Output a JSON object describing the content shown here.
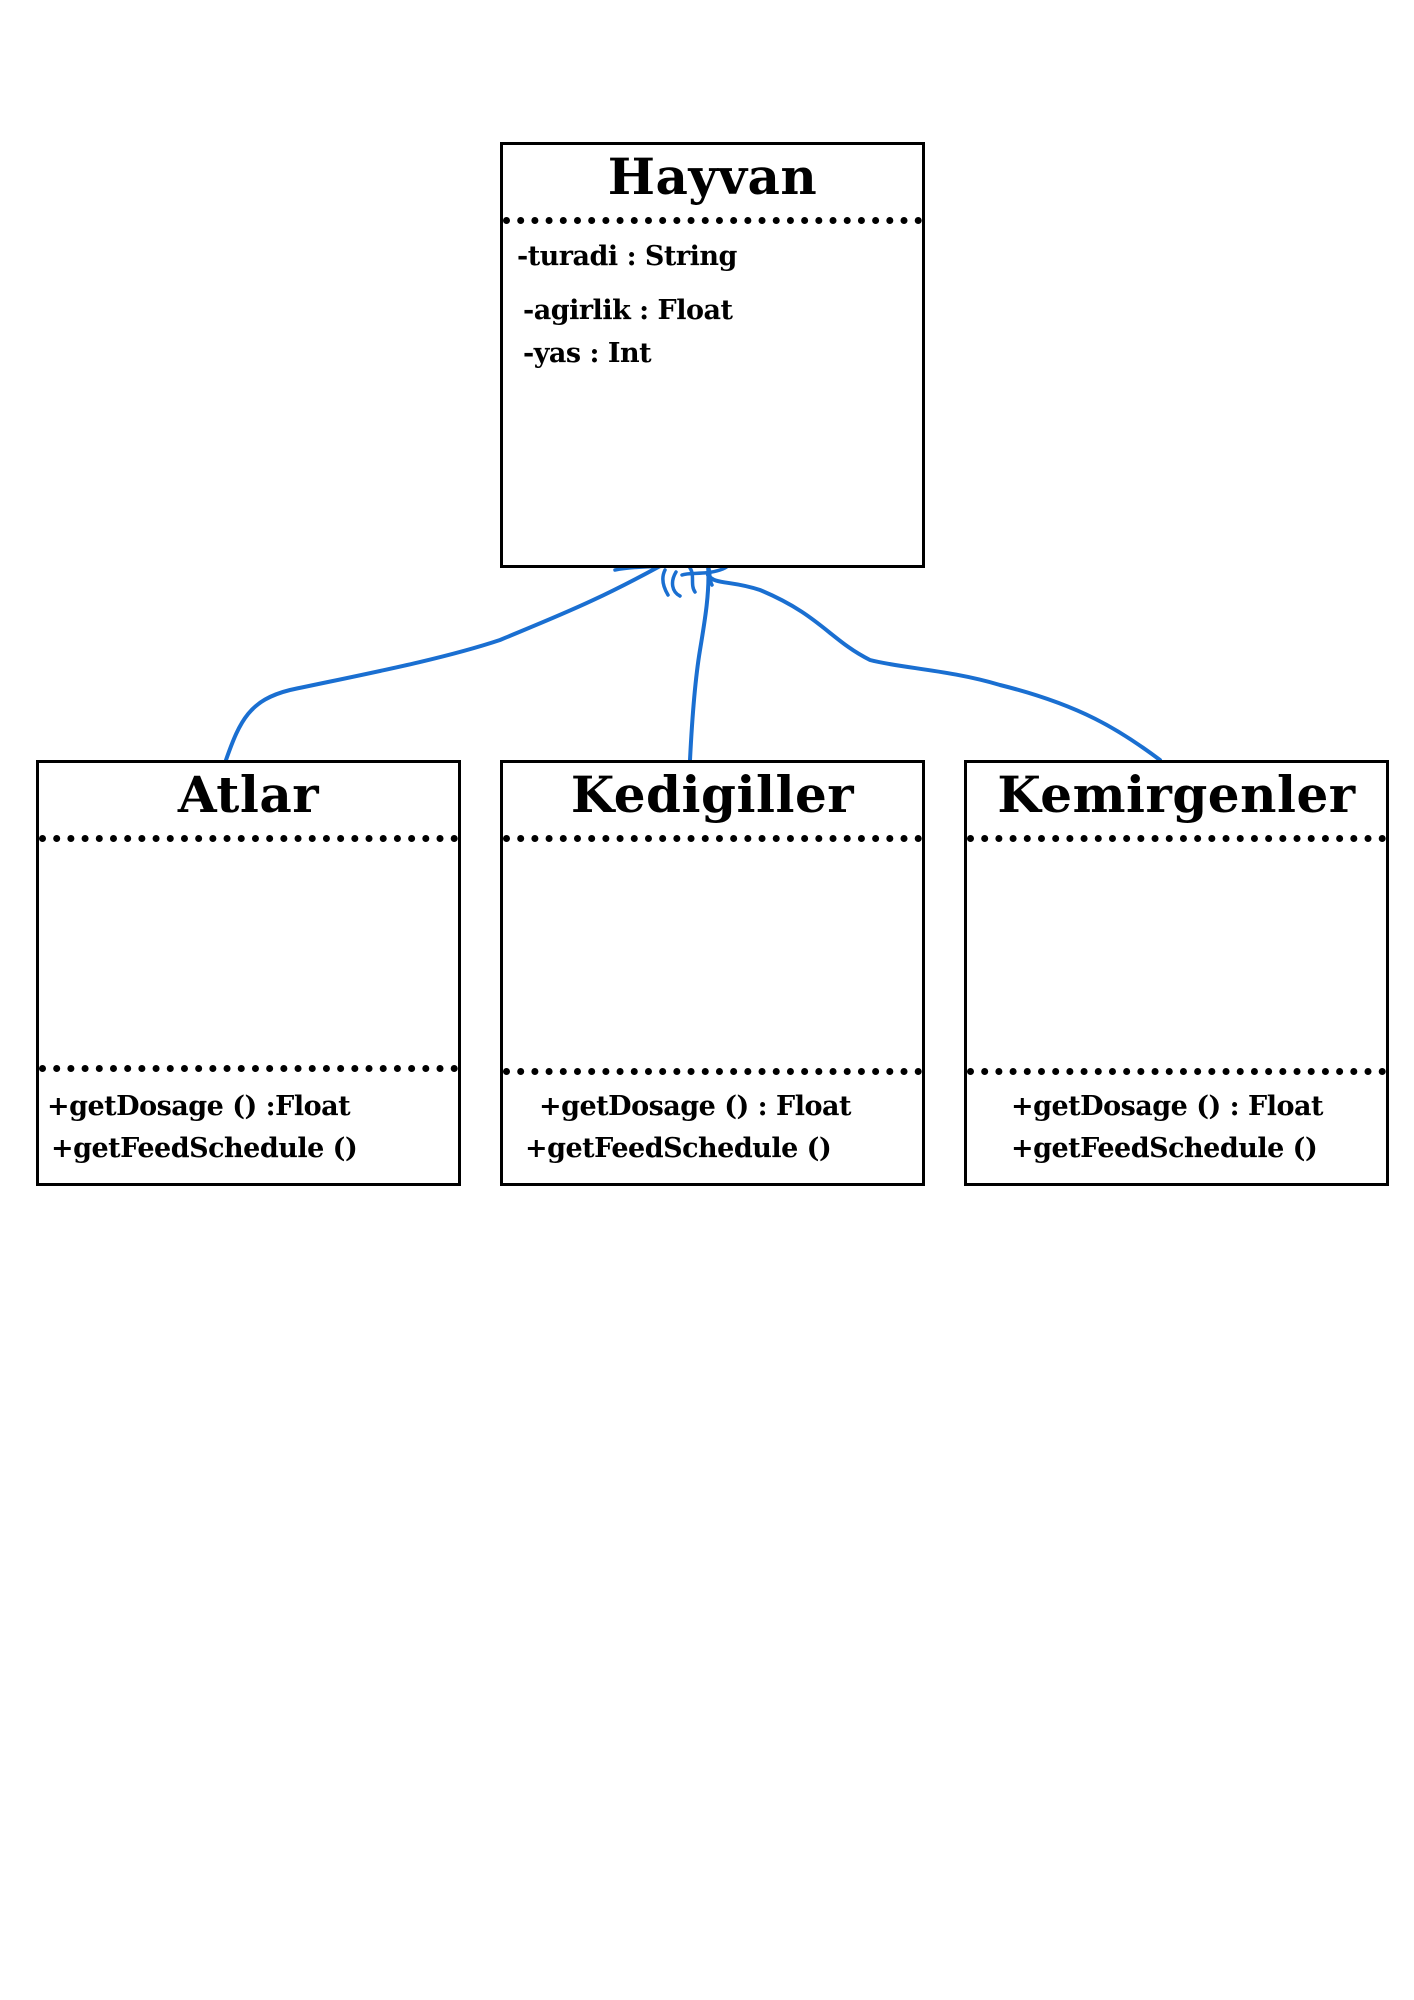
{
  "parent": {
    "title": "Hayvan",
    "attributes": [
      "-turadi : String",
      "-agirlik : Float",
      "-yas : Int"
    ]
  },
  "children": [
    {
      "title": "Atlar",
      "methods": [
        "+getDosage () :Float",
        "+getFeedSchedule ()"
      ]
    },
    {
      "title": "Kedigiller",
      "methods": [
        "+getDosage () : Float",
        "+getFeedSchedule ()"
      ]
    },
    {
      "title": "Kemirgenler",
      "methods": [
        "+getDosage () : Float",
        "+getFeedSchedule ()"
      ]
    }
  ],
  "colors": {
    "connector": "#1a6fd1",
    "border": "#000000"
  }
}
